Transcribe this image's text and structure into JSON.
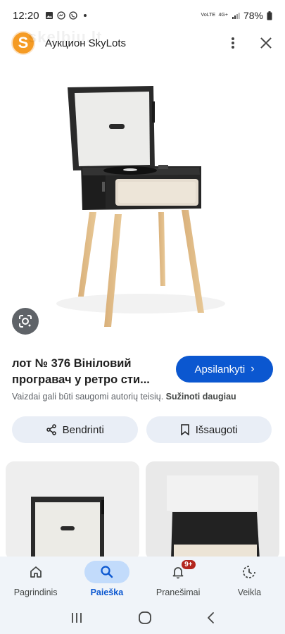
{
  "status_bar": {
    "time": "12:20",
    "network_label": "VoLTE",
    "signal_label": "4G+",
    "battery": "78%"
  },
  "header": {
    "logo_letter": "S",
    "title": "Аукцион SkyLots",
    "watermark": "skelbiu.lt"
  },
  "result": {
    "title": "лот № 376 Вініловий програвач у ретро сти...",
    "visit_label": "Apsilankyti",
    "copyright_text": "Vaizdai gali būti saugomi autorių teisių.",
    "learn_more": "Sužinoti daugiau"
  },
  "actions": {
    "share_label": "Bendrinti",
    "save_label": "Išsaugoti"
  },
  "bottom_nav": {
    "items": [
      {
        "label": "Pagrindinis",
        "icon": "home-icon"
      },
      {
        "label": "Paieška",
        "icon": "search-icon",
        "active": true
      },
      {
        "label": "Pranešimai",
        "icon": "bell-icon",
        "badge": "9+"
      },
      {
        "label": "Veikla",
        "icon": "activity-icon"
      }
    ]
  },
  "colors": {
    "accent": "#0b57d0",
    "pill_bg": "#e9eef6",
    "nav_bg": "#f0f4f9",
    "badge": "#b3261e",
    "logo": "#f59b24"
  }
}
